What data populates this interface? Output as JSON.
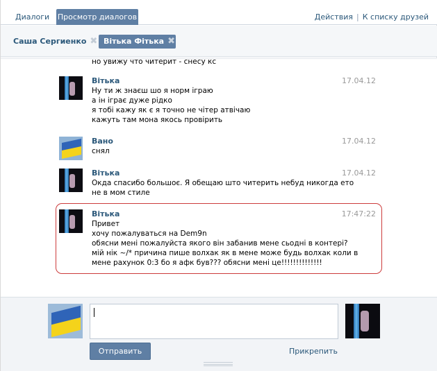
{
  "tabs": [
    {
      "label": "Диалоги"
    },
    {
      "label": "Просмотр диалогов"
    }
  ],
  "top_actions": {
    "actions": "Действия",
    "separator": "|",
    "friends": "К списку друзей"
  },
  "dialogs": [
    {
      "name": "Саша Сергиенко",
      "close": "✖"
    },
    {
      "name": "Вітька Фітька",
      "close": "✖"
    }
  ],
  "messages": {
    "cut_line": "но увижу что читерит - снесу кс",
    "items": [
      {
        "author": "Вітька",
        "time": "17.04.12",
        "lines": [
          "Ну ти ж знаєш шо я норм іграю",
          "а ін іграє дуже рідко",
          "я тобі кажу як є я точно не чітер атвічаю",
          "кажуть там мона якось провірить"
        ]
      },
      {
        "author": "Вано",
        "time": "17.04.12",
        "lines": [
          "снял"
        ]
      },
      {
        "author": "Вітька",
        "time": "17.04.12",
        "lines": [
          "Окда спасибо большоє. Я обещаю што читерить небуд никогда ето",
          "не в мом стиле"
        ]
      },
      {
        "author": "Вітька",
        "time": "17:47:22",
        "lines": [
          "Привет",
          "хочу пожалуваться на Dem9n",
          "обясни мені пожалуйста якого він забанив мене сьодні в контері?",
          "мій нік ~/* причина пише волхак як в мене може будь волхак коли в",
          "мене рахунок 0:3 бо я афк був??? обясни мені це!!!!!!!!!!!!!!"
        ]
      }
    ]
  },
  "composer": {
    "send_label": "Отправить",
    "attach_label": "Прикрепить"
  },
  "colors": {
    "accent": "#5f7fa4",
    "link": "#2b587a",
    "highlight": "#cc3b3b"
  }
}
